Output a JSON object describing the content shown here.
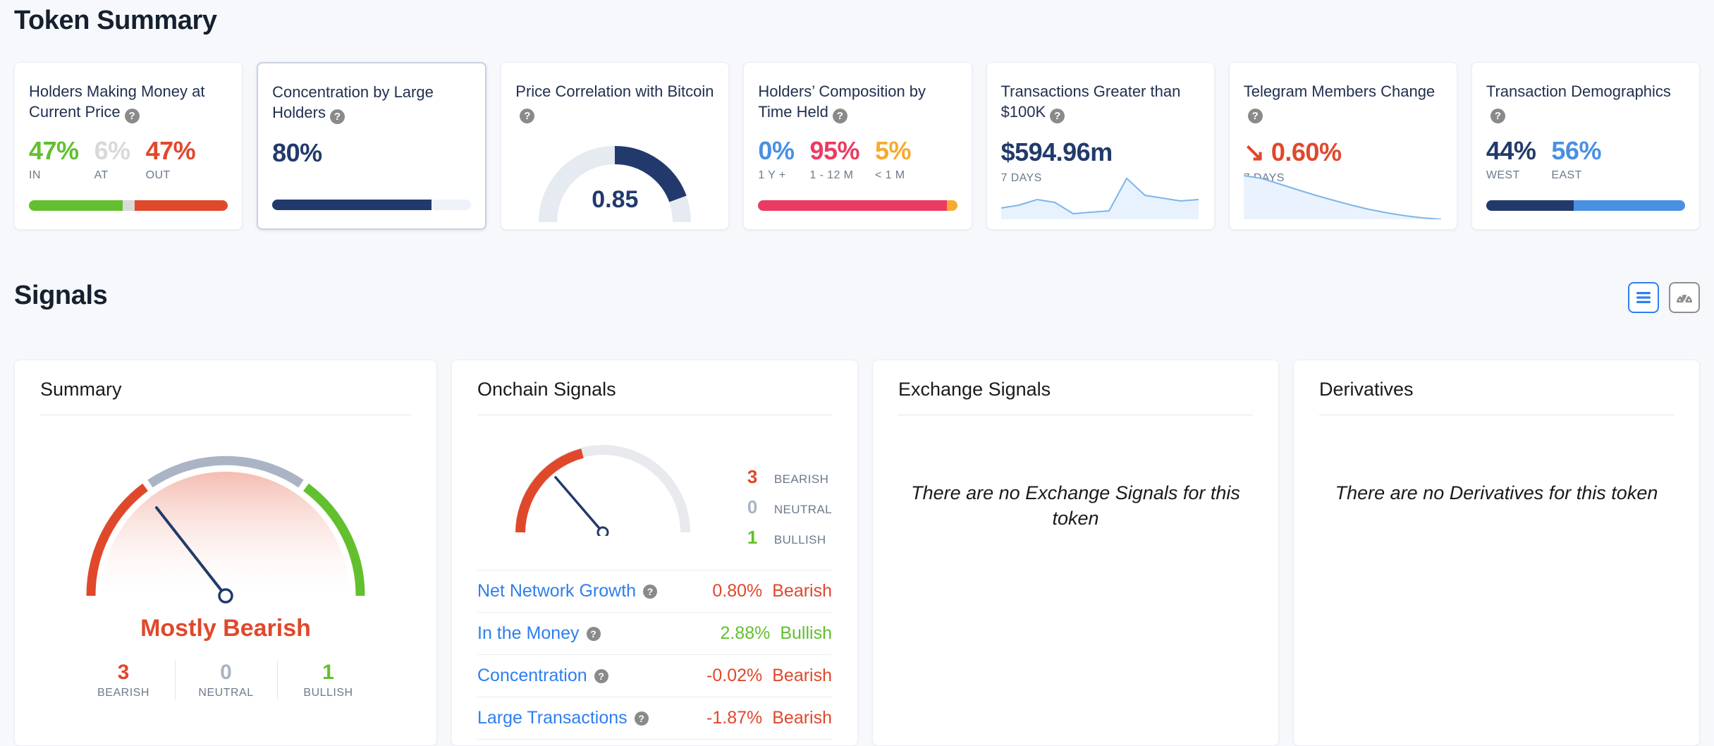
{
  "sections": {
    "token_summary_title": "Token Summary",
    "signals_title": "Signals"
  },
  "colors": {
    "green": "#62c02e",
    "red": "#e0482c",
    "navy": "#223a6b",
    "blue": "#4a90e2",
    "pink": "#ec3b63",
    "amber": "#f6ab2f",
    "grey": "#d9d9d9",
    "accent_blue": "#2d7ff0"
  },
  "cards": [
    {
      "title": "Holders Making Money at Current Price",
      "help_icon": "question-mark-icon",
      "stats": [
        {
          "value": "47%",
          "label": "IN",
          "color": "#62c02e"
        },
        {
          "value": "6%",
          "label": "AT",
          "color": "#d9d9d9"
        },
        {
          "value": "47%",
          "label": "OUT",
          "color": "#e0482c"
        }
      ],
      "bar": [
        {
          "pct": 47,
          "color": "#62c02e"
        },
        {
          "pct": 6,
          "color": "#d9d9d9"
        },
        {
          "pct": 47,
          "color": "#e0482c"
        }
      ]
    },
    {
      "title": "Concentration by Large Holders",
      "help_icon": "question-mark-icon",
      "selected": true,
      "value": "80%",
      "bar": [
        {
          "pct": 80,
          "color": "#223a6b"
        },
        {
          "pct": 20,
          "color": "#eef3fa"
        }
      ]
    },
    {
      "title": "Price Correlation with Bitcoin",
      "help_icon": "question-mark-icon",
      "gauge_value": "0.85",
      "gauge_fraction": 0.85,
      "gauge_fill": "#223a6b",
      "gauge_track": "#e6eaf1"
    },
    {
      "title": "Holders’ Composition by Time Held",
      "help_icon": "question-mark-icon",
      "stats": [
        {
          "value": "0%",
          "label": "1 Y +",
          "color": "#4a90e2"
        },
        {
          "value": "95%",
          "label": "1 - 12 M",
          "color": "#ec3b63"
        },
        {
          "value": "5%",
          "label": "< 1 M",
          "color": "#f6ab2f"
        }
      ],
      "bar": [
        {
          "pct": 0,
          "color": "#4a90e2"
        },
        {
          "pct": 95,
          "color": "#ec3b63"
        },
        {
          "pct": 5,
          "color": "#f6ab2f"
        }
      ]
    },
    {
      "title": "Transactions Greater than $100K",
      "help_icon": "question-mark-icon",
      "value": "$594.96m",
      "period": "7 DAYS",
      "sparkline": [
        18,
        22,
        30,
        26,
        10,
        12,
        14,
        72,
        48,
        44,
        40,
        42
      ]
    },
    {
      "title": "Telegram Members Change",
      "help_icon": "question-mark-icon",
      "value": "0.60%",
      "value_prefix": "↘",
      "value_color": "#e0482c",
      "period": "7 DAYS",
      "sparkline": [
        68,
        64,
        56,
        48,
        40,
        33,
        26,
        19,
        12,
        6,
        2,
        0
      ]
    },
    {
      "title": "Transaction Demographics",
      "help_icon": "question-mark-icon",
      "stats": [
        {
          "value": "44%",
          "label": "WEST",
          "color": "#223a6b"
        },
        {
          "value": "56%",
          "label": "EAST",
          "color": "#4a90e2"
        }
      ],
      "bar": [
        {
          "pct": 44,
          "color": "#223a6b"
        },
        {
          "pct": 56,
          "color": "#4a90e2"
        }
      ]
    }
  ],
  "toggles": [
    {
      "name": "list-view-toggle",
      "icon": "list-icon",
      "active": true
    },
    {
      "name": "gauge-view-toggle",
      "icon": "gauge-icon",
      "active": false
    }
  ],
  "summary_panel": {
    "title": "Summary",
    "verdict": "Mostly Bearish",
    "verdict_color": "#e0482c",
    "needle_fraction": 0.21,
    "counts": [
      {
        "num": "3",
        "label": "BEARISH",
        "color": "#e0482c"
      },
      {
        "num": "0",
        "label": "NEUTRAL",
        "color": "#aab4c4"
      },
      {
        "num": "1",
        "label": "BULLISH",
        "color": "#62c02e"
      }
    ]
  },
  "onchain_panel": {
    "title": "Onchain Signals",
    "needle_fraction": 0.21,
    "legend": [
      {
        "num": "3",
        "label": "BEARISH",
        "color": "#e0482c"
      },
      {
        "num": "0",
        "label": "NEUTRAL",
        "color": "#aab4c4"
      },
      {
        "num": "1",
        "label": "BULLISH",
        "color": "#62c02e"
      }
    ],
    "signals": [
      {
        "name": "Net Network Growth",
        "help_icon": "question-mark-icon",
        "change": "0.80%",
        "verdict": "Bearish",
        "color": "#e0482c"
      },
      {
        "name": "In the Money",
        "help_icon": "question-mark-icon",
        "change": "2.88%",
        "verdict": "Bullish",
        "color": "#62c02e"
      },
      {
        "name": "Concentration",
        "help_icon": "question-mark-icon",
        "change": "-0.02%",
        "verdict": "Bearish",
        "color": "#e0482c"
      },
      {
        "name": "Large Transactions",
        "help_icon": "question-mark-icon",
        "change": "-1.87%",
        "verdict": "Bearish",
        "color": "#e0482c"
      }
    ]
  },
  "exchange_panel": {
    "title": "Exchange Signals",
    "empty_message": "There are no Exchange Signals for this token"
  },
  "derivatives_panel": {
    "title": "Derivatives",
    "empty_message": "There are no Derivatives for this token"
  },
  "chart_data": [
    {
      "type": "bar",
      "title": "Holders Making Money at Current Price",
      "categories": [
        "IN",
        "AT",
        "OUT"
      ],
      "values": [
        47,
        6,
        47
      ],
      "unit": "%"
    },
    {
      "type": "bar",
      "title": "Concentration by Large Holders",
      "categories": [
        "Concentration"
      ],
      "values": [
        80
      ],
      "unit": "%"
    },
    {
      "type": "gauge",
      "title": "Price Correlation with Bitcoin",
      "values": [
        0.85
      ],
      "ylim": [
        0,
        1
      ]
    },
    {
      "type": "bar",
      "title": "Holders' Composition by Time Held",
      "categories": [
        "1 Y +",
        "1 - 12 M",
        "< 1 M"
      ],
      "values": [
        0,
        95,
        5
      ],
      "unit": "%"
    },
    {
      "type": "area",
      "title": "Transactions Greater than $100K",
      "subtitle": "7 DAYS",
      "values": [
        18,
        22,
        30,
        26,
        10,
        12,
        14,
        72,
        48,
        44,
        40,
        42
      ],
      "total": "$594.96m"
    },
    {
      "type": "area",
      "title": "Telegram Members Change",
      "subtitle": "7 DAYS",
      "values": [
        68,
        64,
        56,
        48,
        40,
        33,
        26,
        19,
        12,
        6,
        2,
        0
      ],
      "total": "0.60%"
    },
    {
      "type": "bar",
      "title": "Transaction Demographics",
      "categories": [
        "WEST",
        "EAST"
      ],
      "values": [
        44,
        56
      ],
      "unit": "%"
    },
    {
      "type": "gauge",
      "title": "Summary",
      "categories": [
        "BEARISH",
        "NEUTRAL",
        "BULLISH"
      ],
      "values": [
        3,
        0,
        1
      ],
      "annotation": "Mostly Bearish"
    },
    {
      "type": "gauge",
      "title": "Onchain Signals",
      "categories": [
        "BEARISH",
        "NEUTRAL",
        "BULLISH"
      ],
      "values": [
        3,
        0,
        1
      ]
    }
  ]
}
